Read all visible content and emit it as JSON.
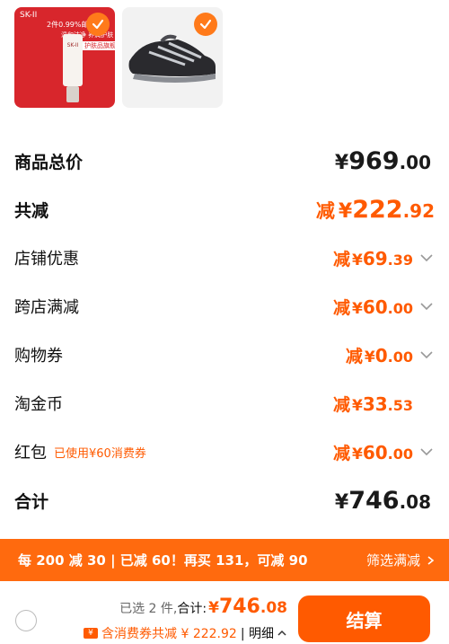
{
  "thumbnails": [
    {
      "name": "product-thumb-sk2",
      "logo": "SK-II",
      "tag": "2件0.99%邮",
      "tag2": "温和洁净 养润护肤",
      "badge": "护肤品旗舰 110",
      "selected": true
    },
    {
      "name": "product-thumb-shoe",
      "selected": true
    }
  ],
  "summary": {
    "total": {
      "label": "商品总价",
      "currency": "¥",
      "int": "969",
      "dec": ".00"
    },
    "reduce": {
      "label": "共减",
      "prefix": "减",
      "currency": "¥",
      "int": "222",
      "dec": ".92"
    },
    "shop_discount": {
      "label": "店铺优惠",
      "prefix": "减",
      "currency": "¥",
      "int": "69",
      "dec": ".39"
    },
    "cross_store": {
      "label": "跨店满减",
      "prefix": "减",
      "currency": "¥",
      "int": "60",
      "dec": ".00"
    },
    "coupon": {
      "label": "购物券",
      "prefix": "减",
      "currency": "¥",
      "int": "0",
      "dec": ".00"
    },
    "taojinbi": {
      "label": "淘金币",
      "prefix": "减",
      "currency": "¥",
      "int": "33",
      "dec": ".53"
    },
    "redpacket": {
      "label": "红包",
      "sub": "已使用¥60消费券",
      "prefix": "减",
      "currency": "¥",
      "int": "60",
      "dec": ".00"
    },
    "sum": {
      "label": "合计",
      "currency": "¥",
      "int": "746",
      "dec": ".08"
    }
  },
  "promo": {
    "text": "每 200 减 30 | 已减 60！再买 131，可减 90",
    "link": "筛选满减"
  },
  "bottom": {
    "selected": "已选 2 件,",
    "heji": "合计:",
    "currency": "¥",
    "int": "746",
    "dec": ".08",
    "discount": "含消费券共减 ¥ 222.92",
    "detail": "| 明细",
    "checkout": "结算"
  },
  "colors": {
    "accent": "#ff5a00",
    "promo_bar": "#ff6a0e",
    "check": "#ff7a1a"
  }
}
